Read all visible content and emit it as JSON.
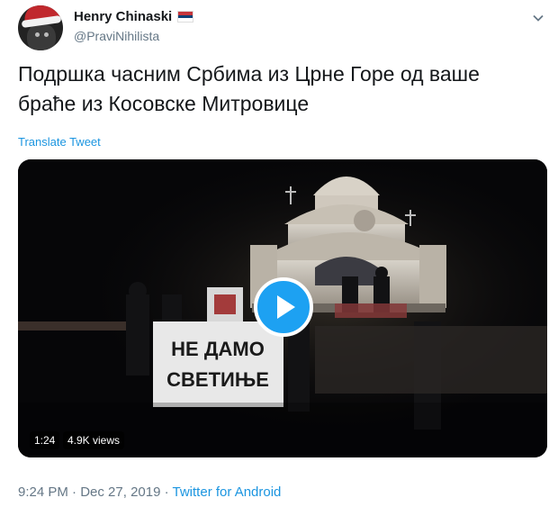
{
  "user": {
    "display_name": "Henry Chinaski",
    "handle": "@PraviNihilista"
  },
  "tweet": {
    "text_line1": "Подршка часним Србима из Црне Горе од ваше",
    "text_line2": "браће из Косовске Митровице",
    "translate_label": "Translate Tweet"
  },
  "video": {
    "duration": "1:24",
    "views": "4.9K views",
    "banner_line1": "НЕ ДАМО",
    "banner_line2": "СВЕТИЊЕ"
  },
  "meta": {
    "time": "9:24 PM",
    "separator1": " · ",
    "date": "Dec 27, 2019",
    "separator2": " · ",
    "source": "Twitter for Android"
  },
  "colors": {
    "link": "#1b95e0",
    "play_button": "#1da1f2",
    "secondary_text": "#657786",
    "flag": [
      "#c6363c",
      "#0c4076",
      "#ffffff"
    ]
  },
  "icons": {
    "caret": "chevron-down-icon",
    "play": "play-icon",
    "flag": "serbia-flag-icon"
  }
}
